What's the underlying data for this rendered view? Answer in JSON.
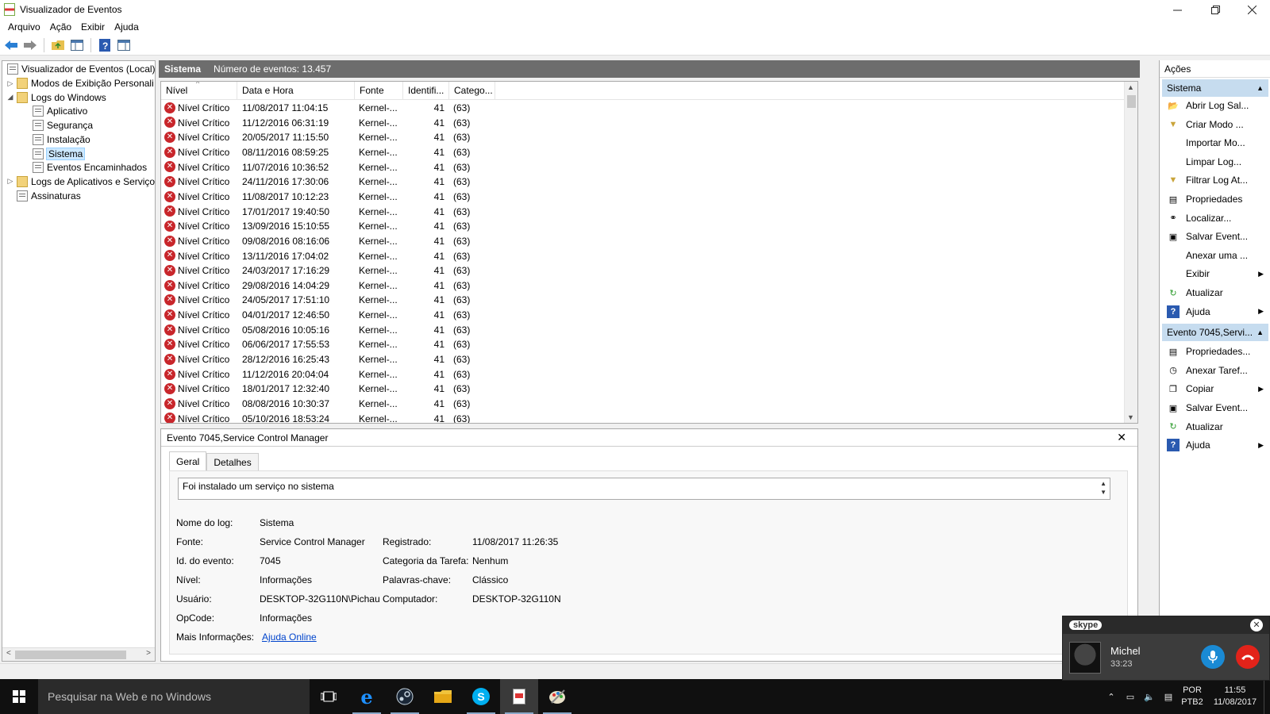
{
  "window": {
    "title": "Visualizador de Eventos"
  },
  "menu": [
    "Arquivo",
    "Ação",
    "Exibir",
    "Ajuda"
  ],
  "tree": {
    "root": "Visualizador de Eventos (Local)",
    "items": [
      {
        "label": "Modos de Exibição Personali",
        "level": 1,
        "expander": "▷",
        "icon": "folder"
      },
      {
        "label": "Logs do Windows",
        "level": 1,
        "expander": "◢",
        "icon": "folder"
      },
      {
        "label": "Aplicativo",
        "level": 2,
        "expander": "",
        "icon": "log"
      },
      {
        "label": "Segurança",
        "level": 2,
        "expander": "",
        "icon": "log"
      },
      {
        "label": "Instalação",
        "level": 2,
        "expander": "",
        "icon": "log"
      },
      {
        "label": "Sistema",
        "level": 2,
        "expander": "",
        "icon": "log",
        "selected": true
      },
      {
        "label": "Eventos Encaminhados",
        "level": 2,
        "expander": "",
        "icon": "log"
      },
      {
        "label": "Logs de Aplicativos e Serviço",
        "level": 1,
        "expander": "▷",
        "icon": "folder"
      },
      {
        "label": "Assinaturas",
        "level": 1,
        "expander": "",
        "icon": "log"
      }
    ]
  },
  "center": {
    "title": "Sistema",
    "count": "Número de eventos: 13.457"
  },
  "events": {
    "columns": [
      "Nível",
      "Data e Hora",
      "Fonte",
      "Identifi...",
      "Catego..."
    ],
    "rows": [
      [
        "Nível Crítico",
        "11/08/2017 11:04:15",
        "Kernel-...",
        "41",
        "(63)"
      ],
      [
        "Nível Crítico",
        "11/12/2016 06:31:19",
        "Kernel-...",
        "41",
        "(63)"
      ],
      [
        "Nível Crítico",
        "20/05/2017 11:15:50",
        "Kernel-...",
        "41",
        "(63)"
      ],
      [
        "Nível Crítico",
        "08/11/2016 08:59:25",
        "Kernel-...",
        "41",
        "(63)"
      ],
      [
        "Nível Crítico",
        "11/07/2016 10:36:52",
        "Kernel-...",
        "41",
        "(63)"
      ],
      [
        "Nível Crítico",
        "24/11/2016 17:30:06",
        "Kernel-...",
        "41",
        "(63)"
      ],
      [
        "Nível Crítico",
        "11/08/2017 10:12:23",
        "Kernel-...",
        "41",
        "(63)"
      ],
      [
        "Nível Crítico",
        "17/01/2017 19:40:50",
        "Kernel-...",
        "41",
        "(63)"
      ],
      [
        "Nível Crítico",
        "13/09/2016 15:10:55",
        "Kernel-...",
        "41",
        "(63)"
      ],
      [
        "Nível Crítico",
        "09/08/2016 08:16:06",
        "Kernel-...",
        "41",
        "(63)"
      ],
      [
        "Nível Crítico",
        "13/11/2016 17:04:02",
        "Kernel-...",
        "41",
        "(63)"
      ],
      [
        "Nível Crítico",
        "24/03/2017 17:16:29",
        "Kernel-...",
        "41",
        "(63)"
      ],
      [
        "Nível Crítico",
        "29/08/2016 14:04:29",
        "Kernel-...",
        "41",
        "(63)"
      ],
      [
        "Nível Crítico",
        "24/05/2017 17:51:10",
        "Kernel-...",
        "41",
        "(63)"
      ],
      [
        "Nível Crítico",
        "04/01/2017 12:46:50",
        "Kernel-...",
        "41",
        "(63)"
      ],
      [
        "Nível Crítico",
        "05/08/2016 10:05:16",
        "Kernel-...",
        "41",
        "(63)"
      ],
      [
        "Nível Crítico",
        "06/06/2017 17:55:53",
        "Kernel-...",
        "41",
        "(63)"
      ],
      [
        "Nível Crítico",
        "28/12/2016 16:25:43",
        "Kernel-...",
        "41",
        "(63)"
      ],
      [
        "Nível Crítico",
        "11/12/2016 20:04:04",
        "Kernel-...",
        "41",
        "(63)"
      ],
      [
        "Nível Crítico",
        "18/01/2017 12:32:40",
        "Kernel-...",
        "41",
        "(63)"
      ],
      [
        "Nível Crítico",
        "08/08/2016 10:30:37",
        "Kernel-...",
        "41",
        "(63)"
      ],
      [
        "Nível Crítico",
        "05/10/2016 18:53:24",
        "Kernel-...",
        "41",
        "(63)"
      ]
    ]
  },
  "detail": {
    "title": "Evento 7045,Service Control Manager",
    "tabs": [
      "Geral",
      "Detalhes"
    ],
    "description": "Foi instalado um serviço no sistema",
    "fields": {
      "log_label": "Nome do log:",
      "log_value": "Sistema",
      "source_label": "Fonte:",
      "source_value": "Service Control Manager",
      "logged_label": "Registrado:",
      "logged_value": "11/08/2017 11:26:35",
      "id_label": "Id. do evento:",
      "id_value": "7045",
      "task_label": "Categoria da Tarefa:",
      "task_value": "Nenhum",
      "level_label": "Nível:",
      "level_value": "Informações",
      "keywords_label": "Palavras-chave:",
      "keywords_value": "Clássico",
      "user_label": "Usuário:",
      "user_value": "DESKTOP-32G110N\\Pichau",
      "computer_label": "Computador:",
      "computer_value": "DESKTOP-32G110N",
      "opcode_label": "OpCode:",
      "opcode_value": "Informações",
      "more_label": "Mais Informações:",
      "more_link": "Ajuda Online"
    }
  },
  "actions": {
    "title": "Ações",
    "section1": "Sistema",
    "items1": [
      {
        "label": "Abrir Log Sal...",
        "icon": "folder-open-icon",
        "glyph": "📂",
        "sub": false
      },
      {
        "label": "Criar Modo ...",
        "icon": "filter-icon",
        "glyph": "▼",
        "sub": false
      },
      {
        "label": "Importar Mo...",
        "icon": "",
        "glyph": "",
        "sub": false
      },
      {
        "label": "Limpar Log...",
        "icon": "",
        "glyph": "",
        "sub": false
      },
      {
        "label": "Filtrar Log At...",
        "icon": "filter-icon",
        "glyph": "▼",
        "sub": false
      },
      {
        "label": "Propriedades",
        "icon": "properties-icon",
        "glyph": "▤",
        "sub": false
      },
      {
        "label": "Localizar...",
        "icon": "binoculars-icon",
        "glyph": "⚭",
        "sub": false
      },
      {
        "label": "Salvar Event...",
        "icon": "save-icon",
        "glyph": "▣",
        "sub": false
      },
      {
        "label": "Anexar uma ...",
        "icon": "",
        "glyph": "",
        "sub": false
      },
      {
        "label": "Exibir",
        "icon": "",
        "glyph": "",
        "sub": true
      },
      {
        "label": "Atualizar",
        "icon": "refresh-icon",
        "glyph": "↻",
        "sub": false
      },
      {
        "label": "Ajuda",
        "icon": "help-icon",
        "glyph": "?",
        "sub": true
      }
    ],
    "section2": "Evento 7045,Servi...",
    "items2": [
      {
        "label": "Propriedades...",
        "icon": "properties-icon",
        "glyph": "▤",
        "sub": false
      },
      {
        "label": "Anexar Taref...",
        "icon": "task-icon",
        "glyph": "◷",
        "sub": false
      },
      {
        "label": "Copiar",
        "icon": "copy-icon",
        "glyph": "❐",
        "sub": true
      },
      {
        "label": "Salvar Event...",
        "icon": "save-icon",
        "glyph": "▣",
        "sub": false
      },
      {
        "label": "Atualizar",
        "icon": "refresh-icon",
        "glyph": "↻",
        "sub": false
      },
      {
        "label": "Ajuda",
        "icon": "help-icon",
        "glyph": "?",
        "sub": true
      }
    ]
  },
  "taskbar": {
    "search_placeholder": "Pesquisar na Web e no Windows",
    "lang1": "POR",
    "lang2": "PTB2",
    "time": "11:55",
    "date": "11/08/2017"
  },
  "skype": {
    "logo": "skype",
    "name": "Michel",
    "duration": "33:23"
  },
  "colors": {
    "critical": "#c8262b",
    "section": "#c6dcef",
    "taskbar": "#101010",
    "skype_mic": "#1a8ad4",
    "skype_end": "#e2231a"
  }
}
